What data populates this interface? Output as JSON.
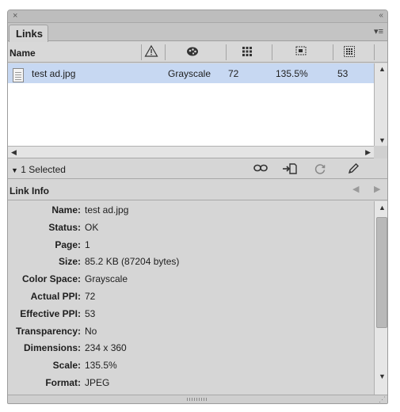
{
  "window": {
    "close_glyph": "×",
    "collapse_glyph": "‹‹",
    "menu_glyph": "▾≡"
  },
  "tab": {
    "label": "Links"
  },
  "columns": {
    "name": "Name",
    "icons": [
      "warning-icon",
      "color-space-icon",
      "actual-ppi-icon",
      "scale-icon",
      "effective-ppi-icon"
    ]
  },
  "links": [
    {
      "name": "test ad.jpg",
      "color_space": "Grayscale",
      "actual_ppi": "72",
      "scale": "135.5%",
      "effective_ppi": "53"
    }
  ],
  "status": {
    "selected": "1 Selected"
  },
  "link_info": {
    "title": "Link Info",
    "fields": [
      {
        "label": "Name:",
        "value": "test ad.jpg"
      },
      {
        "label": "Status:",
        "value": "OK"
      },
      {
        "label": "Page:",
        "value": "1"
      },
      {
        "label": "Size:",
        "value": "85.2 KB (87204 bytes)"
      },
      {
        "label": "Color Space:",
        "value": "Grayscale"
      },
      {
        "label": "Actual PPI:",
        "value": "72"
      },
      {
        "label": "Effective PPI:",
        "value": "53"
      },
      {
        "label": "Transparency:",
        "value": "No"
      },
      {
        "label": "Dimensions:",
        "value": "234 x 360"
      },
      {
        "label": "Scale:",
        "value": "135.5%"
      },
      {
        "label": "Format:",
        "value": "JPEG"
      }
    ]
  }
}
